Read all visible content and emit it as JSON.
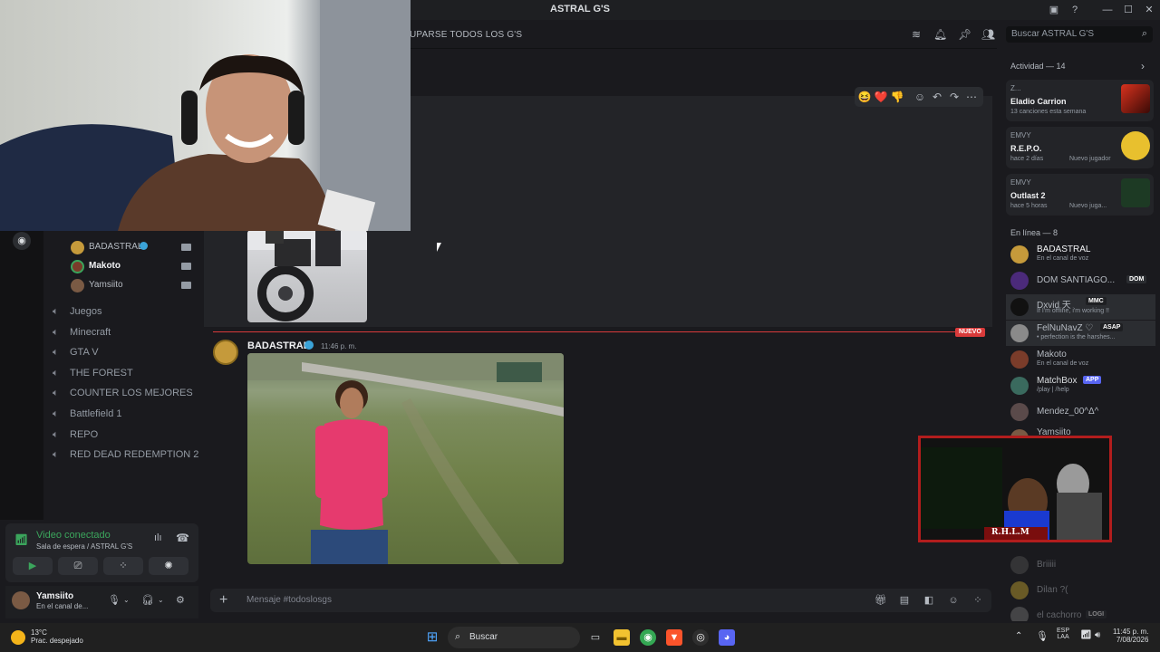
{
  "window": {
    "title": "ASTRAL G'S"
  },
  "header": {
    "channel_name": "UPARSE TODOS LOS G'S",
    "search_placeholder": "Buscar ASTRAL G'S"
  },
  "voice_channel": {
    "users": [
      {
        "name": "BADASTRAL"
      },
      {
        "name": "Makoto"
      },
      {
        "name": "Yamsiito"
      }
    ]
  },
  "channels": [
    "Juegos",
    "Minecraft",
    "GTA V",
    "THE FOREST",
    "COUNTER LOS MEJORES",
    "Battlefield 1",
    "REPO",
    "RED DEAD REDEMPTION 2"
  ],
  "voice_panel": {
    "status": "Video conectado",
    "location": "Sala de espera / ASTRAL G'S"
  },
  "user_panel": {
    "name": "Yamsiito",
    "status": "En el canal de..."
  },
  "messages": {
    "new_badge": "NUEVO",
    "author": "BADASTRAL",
    "time": "11:46 p. m."
  },
  "chat_input": {
    "placeholder": "Mensaje #todoslosgs"
  },
  "activity": {
    "header": "Actividad — 14",
    "cards": [
      {
        "top": "Z...",
        "title": "Eladio Carrion",
        "sub": "13 canciones esta semana"
      },
      {
        "top": "EMVY",
        "title": "R.E.P.O.",
        "sub": "hace 2 días",
        "badge": "Nuevo jugador"
      },
      {
        "top": "EMVY",
        "title": "Outlast 2",
        "sub": "hace 5 horas",
        "badge": "Nuevo juga..."
      }
    ]
  },
  "online": {
    "header": "En línea — 8",
    "members": [
      {
        "name": "BADASTRAL",
        "sub": "En el canal de voz"
      },
      {
        "name": "DOM SANTIAGO...",
        "tag": "DOM"
      },
      {
        "name": "Dxvid 天",
        "tag": "MMC",
        "sub": "If I'm offline, i'm working !!"
      },
      {
        "name": "FelNuNavZ ♡",
        "tag": "ASAP",
        "sub": "• perfection is the harshes..."
      },
      {
        "name": "Makoto",
        "sub": "En el canal de voz"
      },
      {
        "name": "MatchBox",
        "tag": "APP",
        "sub": "/play | /help"
      },
      {
        "name": "Mendez_00^Δ^"
      },
      {
        "name": "Yamsiito"
      }
    ],
    "offline": [
      {
        "name": "Briiiii"
      },
      {
        "name": "Dilan ?("
      },
      {
        "name": "el cachorro",
        "tag": "LOGI"
      }
    ]
  },
  "overlay": {
    "stream_label": "R.H.L.M"
  },
  "taskbar": {
    "temp": "13°C",
    "weather": "Prac. despejado",
    "search": "Buscar",
    "lang_top": "ESP",
    "lang_bottom": "LAA",
    "time": "11:45 p. m.",
    "date": "7/08/2026"
  }
}
